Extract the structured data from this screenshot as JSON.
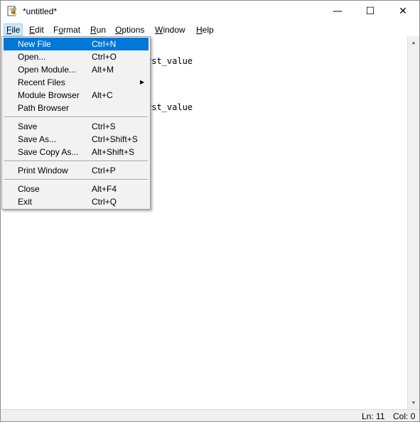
{
  "window": {
    "title": "*untitled*",
    "icon": "python-idle-icon",
    "controls": {
      "minimize": "—",
      "maximize": "☐",
      "close": "✕"
    }
  },
  "menubar": {
    "items": [
      {
        "mnemonic": "F",
        "rest": "ile",
        "active": true
      },
      {
        "mnemonic": "E",
        "rest": "dit"
      },
      {
        "mnemonic": "",
        "pre": "F",
        "mnemonic2": "o",
        "rest": "rmat"
      },
      {
        "mnemonic": "R",
        "rest": "un"
      },
      {
        "mnemonic": "O",
        "rest": "ptions"
      },
      {
        "mnemonic": "W",
        "rest": "indow"
      },
      {
        "mnemonic": "H",
        "rest": "elp"
      }
    ]
  },
  "file_menu": {
    "items": [
      {
        "label": "New File",
        "shortcut": "Ctrl+N",
        "highlighted": true
      },
      {
        "label": "Open...",
        "shortcut": "Ctrl+O"
      },
      {
        "label": "Open Module...",
        "shortcut": "Alt+M"
      },
      {
        "label": "Recent Files",
        "shortcut": "",
        "submenu": true
      },
      {
        "label": "Module Browser",
        "shortcut": "Alt+C"
      },
      {
        "label": "Path Browser",
        "shortcut": ""
      },
      {
        "label": "Save",
        "shortcut": "Ctrl+S"
      },
      {
        "label": "Save As...",
        "shortcut": "Ctrl+Shift+S"
      },
      {
        "label": "Save Copy As...",
        "shortcut": "Alt+Shift+S"
      },
      {
        "label": "Print Window",
        "shortcut": "Ctrl+P"
      },
      {
        "label": "Close",
        "shortcut": "Alt+F4"
      },
      {
        "label": "Exit",
        "shortcut": "Ctrl+Q"
      }
    ],
    "submenu_arrow": "▶"
  },
  "editor": {
    "visible_code_fragments": [
      "rst_value",
      "rst_value"
    ]
  },
  "statusbar": {
    "line": "Ln: 11",
    "col": "Col: 0"
  },
  "scrollbar": {
    "up_arrow": "▲",
    "down_arrow": "▼"
  }
}
